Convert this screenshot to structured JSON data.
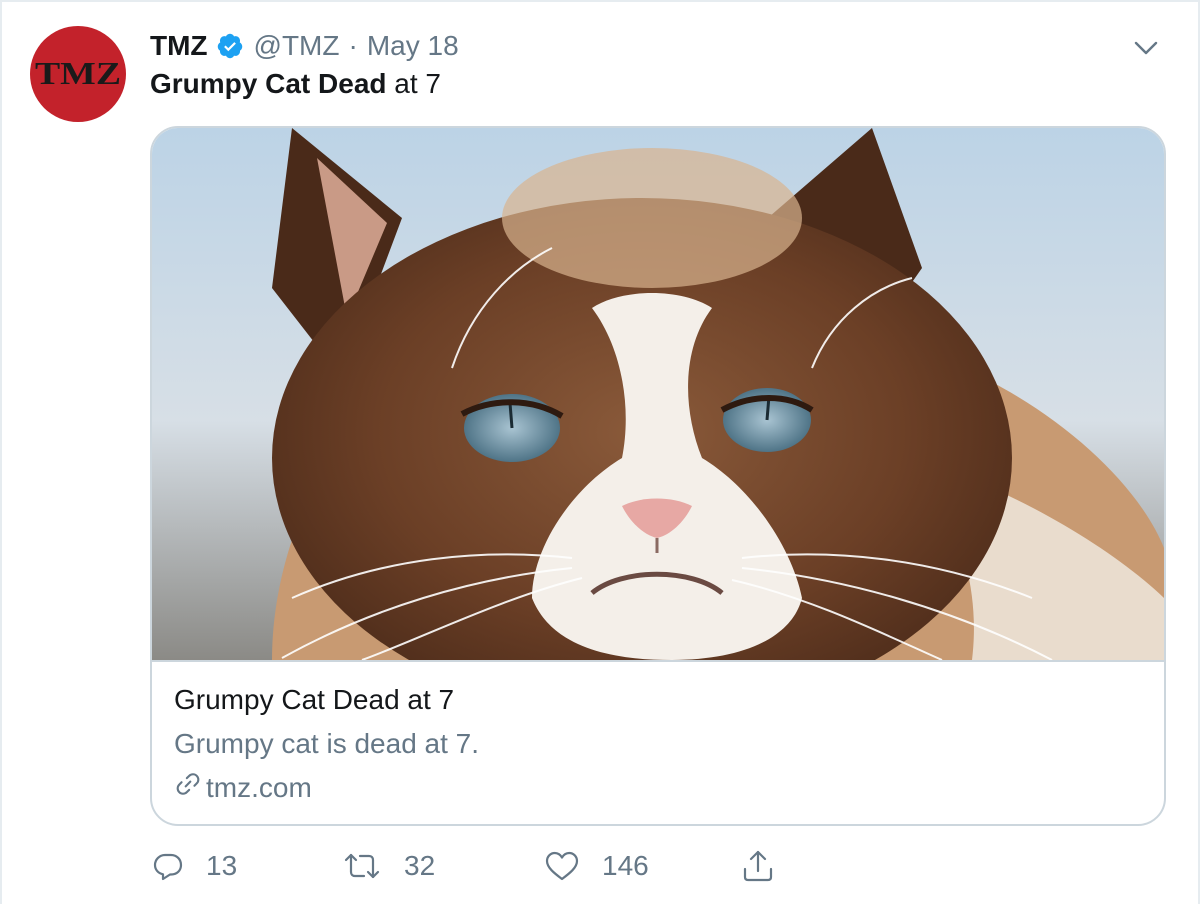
{
  "tweet": {
    "author_name": "TMZ",
    "author_handle": "@TMZ",
    "separator": "·",
    "date": "May 18",
    "text_bold": "Grumpy Cat Dead",
    "text_rest": " at 7",
    "avatar_text": "TMZ",
    "verified_icon": "verified-badge-icon",
    "caret_icon": "chevron-down-icon"
  },
  "card": {
    "title": "Grumpy Cat Dead at 7",
    "description": "Grumpy cat is dead at 7.",
    "domain": "tmz.com",
    "image_icon": "grumpy-cat-photo"
  },
  "actions": {
    "reply_count": "13",
    "retweet_count": "32",
    "like_count": "146",
    "reply_icon": "reply-icon",
    "retweet_icon": "retweet-icon",
    "like_icon": "heart-icon",
    "share_icon": "share-icon"
  },
  "colors": {
    "secondary_text": "#657786",
    "verified_blue": "#1da1f2",
    "tmz_red": "#c3222b",
    "border": "#ccd6dd"
  }
}
